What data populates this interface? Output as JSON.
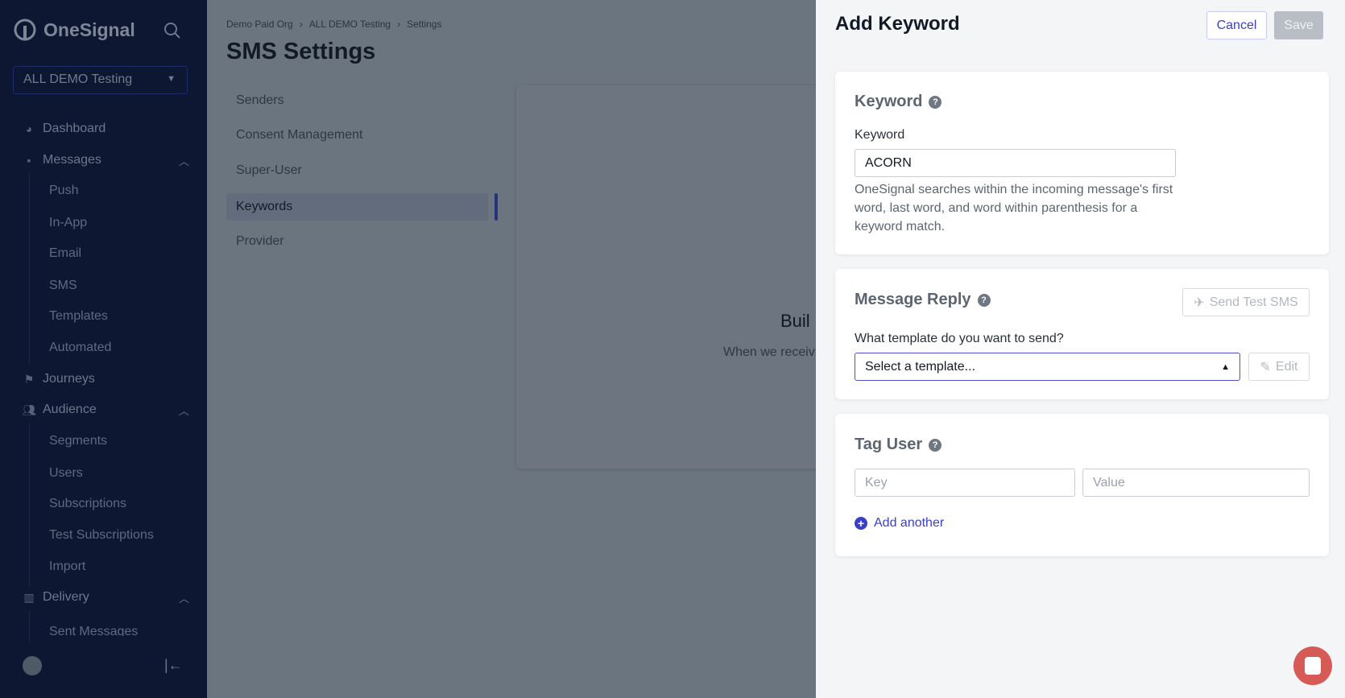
{
  "sidebar": {
    "brand": "OneSignal",
    "app_selector": "ALL DEMO Testing",
    "items": [
      {
        "label": "Dashboard",
        "icon": "dashboard-icon"
      },
      {
        "label": "Messages",
        "icon": "message-icon"
      },
      {
        "label": "Push"
      },
      {
        "label": "In-App"
      },
      {
        "label": "Email"
      },
      {
        "label": "SMS"
      },
      {
        "label": "Templates"
      },
      {
        "label": "Automated"
      },
      {
        "label": "Journeys",
        "icon": "journeys-icon"
      },
      {
        "label": "Audience",
        "icon": "audience-icon"
      },
      {
        "label": "Segments"
      },
      {
        "label": "Users"
      },
      {
        "label": "Subscriptions"
      },
      {
        "label": "Test Subscriptions"
      },
      {
        "label": "Import"
      },
      {
        "label": "Delivery",
        "icon": "chart-icon"
      },
      {
        "label": "Sent Messages"
      }
    ]
  },
  "main": {
    "breadcrumb": [
      "Demo Paid Org",
      "ALL DEMO Testing",
      "Settings"
    ],
    "title": "SMS Settings",
    "subnav": [
      "Senders",
      "Consent Management",
      "Super-User",
      "Keywords",
      "Provider"
    ],
    "active_subnav": "Keywords",
    "empty_title": "Buil",
    "empty_sub": "When we receiv"
  },
  "panel": {
    "title": "Add Keyword",
    "cancel": "Cancel",
    "save": "Save",
    "keyword": {
      "heading": "Keyword",
      "label": "Keyword",
      "value": "ACORN",
      "help": "OneSignal searches within the incoming message's first word, last word, and word within parenthesis for a keyword match."
    },
    "reply": {
      "heading": "Message Reply",
      "send_test": "Send Test SMS",
      "label": "What template do you want to send?",
      "select_value": "Select a template...",
      "edit": "Edit"
    },
    "tag": {
      "heading": "Tag User",
      "key_placeholder": "Key",
      "value_placeholder": "Value",
      "add_another": "Add another"
    }
  },
  "colors": {
    "accent": "#3b3fc6",
    "sidebar": "#0e1731",
    "chat": "#d65a55"
  }
}
